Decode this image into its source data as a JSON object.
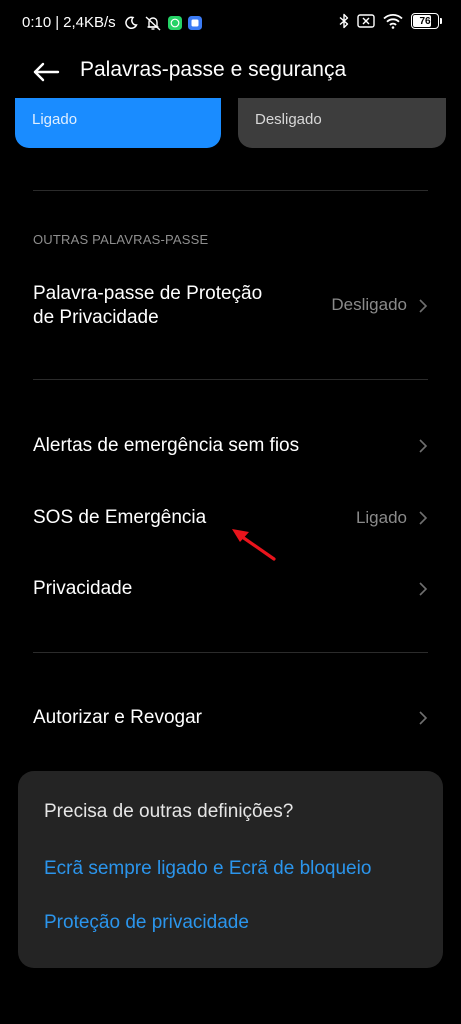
{
  "status_bar": {
    "time": "0:10",
    "separator": "|",
    "speed": "2,4KB/s",
    "battery": "76",
    "battery_level": 0.76
  },
  "header": {
    "title": "Palavras-passe e segurança"
  },
  "toggle_cards": [
    {
      "state": "Ligado"
    },
    {
      "state": "Desligado"
    }
  ],
  "section": {
    "header": "OUTRAS PALAVRAS-PASSE"
  },
  "rows": {
    "privacy_password": {
      "label_line1": "Palavra-passe de Proteção",
      "label_line2": "de Privacidade",
      "value": "Desligado"
    },
    "wireless_alerts": {
      "label": "Alertas de emergência sem fios"
    },
    "sos": {
      "label": "SOS de Emergência",
      "value": "Ligado"
    },
    "privacy": {
      "label": "Privacidade"
    },
    "authorize": {
      "label": "Autorizar e Revogar"
    }
  },
  "suggestions": {
    "title": "Precisa de outras definições?",
    "links": [
      "Ecrã sempre ligado e Ecrã de bloqueio",
      "Proteção de privacidade"
    ]
  },
  "colors": {
    "background": "#000000",
    "accent": "#1a8cff",
    "link": "#2b95ec",
    "annotation_arrow": "#e8141c"
  }
}
